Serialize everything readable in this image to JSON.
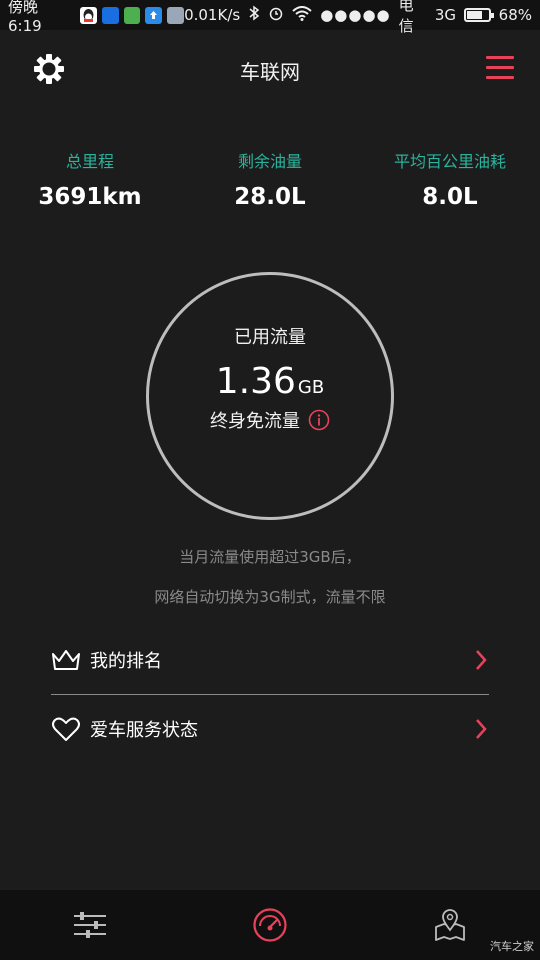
{
  "status_bar": {
    "time": "傍晚6:19",
    "network_speed": "0.01K/s",
    "carrier": "电信",
    "network_type": "3G",
    "battery": "68%",
    "battery_level": 0.68
  },
  "header": {
    "title": "车联网"
  },
  "stats": [
    {
      "label": "总里程",
      "value": "3691km"
    },
    {
      "label": "剩余油量",
      "value": "28.0L"
    },
    {
      "label": "平均百公里油耗",
      "value": "8.0L"
    }
  ],
  "data_usage": {
    "label": "已用流量",
    "value": "1.36",
    "unit": "GB",
    "subtitle": "终身免流量"
  },
  "notice": {
    "line1": "当月流量使用超过3GB后，",
    "line2": "网络自动切换为3G制式，流量不限"
  },
  "menu_items": [
    {
      "label": "我的排名",
      "icon": "crown-icon"
    },
    {
      "label": "爱车服务状态",
      "icon": "heart-icon"
    }
  ],
  "bottom_nav": [
    {
      "icon": "sliders-icon"
    },
    {
      "icon": "speedometer-icon",
      "active": true
    },
    {
      "icon": "map-pin-icon"
    }
  ],
  "watermark": "汽车之家",
  "colors": {
    "accent_red": "#e8425a",
    "accent_teal": "#2bb39d",
    "background": "#1c1c1c"
  }
}
